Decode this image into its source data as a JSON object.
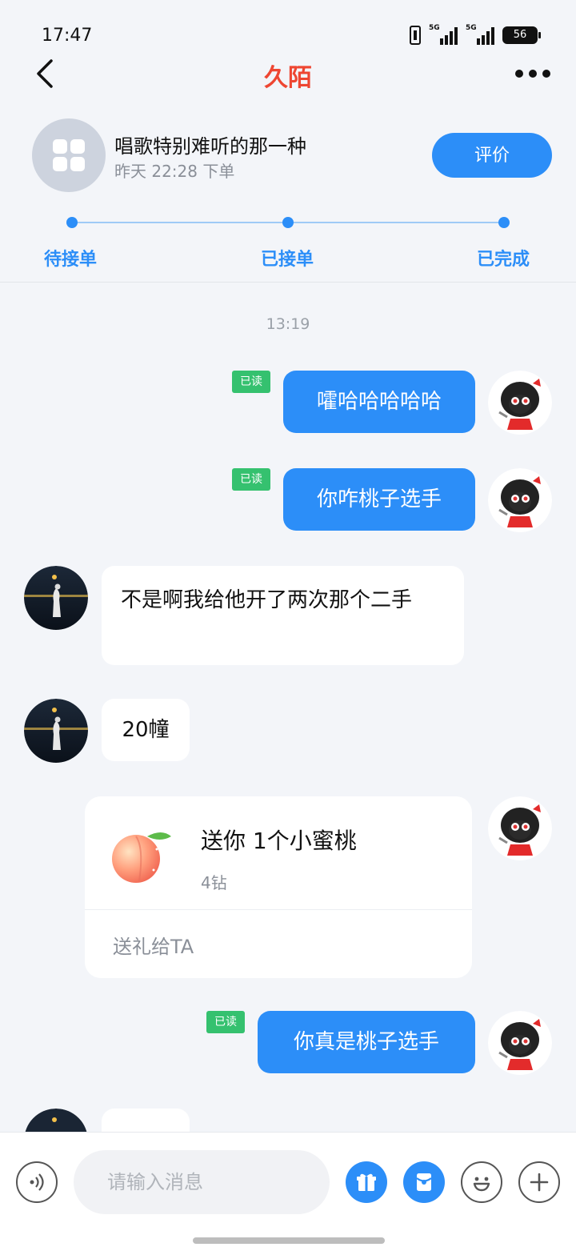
{
  "status_bar": {
    "time": "17:47",
    "signal1_tag": "5G",
    "signal2_tag": "5G",
    "battery": "56"
  },
  "nav": {
    "title": "久陌",
    "back_icon": "chevron-left-icon",
    "more_icon": "more-dots-icon"
  },
  "order": {
    "title": "唱歌特别难听的那一种",
    "time": "昨天 22:28 下单",
    "review_label": "评价",
    "progress_steps": [
      "待接单",
      "已接单",
      "已完成"
    ]
  },
  "chat": {
    "timestamp": "13:19",
    "read_label": "已读",
    "messages": [
      {
        "side": "out",
        "text": "嚯哈哈哈哈哈",
        "read": true
      },
      {
        "side": "out",
        "text": "你咋桃子选手",
        "read": true
      },
      {
        "side": "in",
        "text": "不是啊我给他开了两次那个二手"
      },
      {
        "side": "in",
        "text": "20幢"
      },
      {
        "side": "out",
        "type": "gift"
      },
      {
        "side": "out",
        "text": "你真是桃子选手",
        "read": true
      }
    ],
    "gift": {
      "title": "送你 1个小蜜桃",
      "price": "4钻",
      "footer": "送礼给TA"
    }
  },
  "input_bar": {
    "placeholder": "请输入消息",
    "voice_icon": "voice-icon",
    "gift_icon": "gift-icon",
    "red-packet_icon": "red-packet-icon",
    "emoji_icon": "emoji-icon",
    "add_icon": "add-icon"
  },
  "colors": {
    "accent": "#2c8ef8",
    "title": "#ee4632",
    "read_badge": "#35c16f",
    "background": "#f3f5f9"
  }
}
